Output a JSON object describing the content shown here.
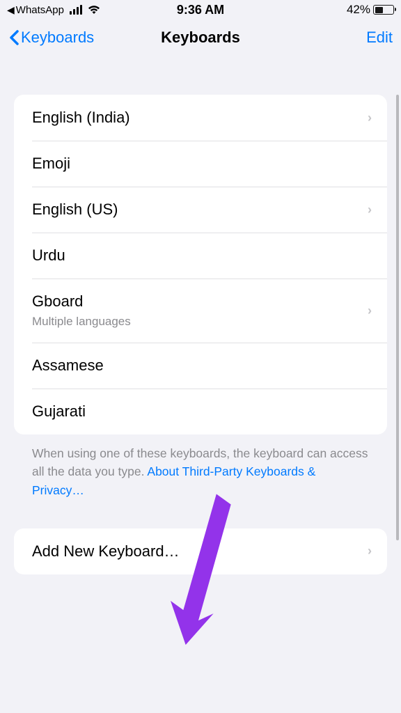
{
  "status_bar": {
    "back_app": "WhatsApp",
    "time": "9:36 AM",
    "battery_percent": "42%"
  },
  "nav": {
    "back_label": "Keyboards",
    "title": "Keyboards",
    "edit_label": "Edit"
  },
  "keyboards": [
    {
      "label": "English (India)",
      "has_chevron": true
    },
    {
      "label": "Emoji",
      "has_chevron": false
    },
    {
      "label": "English (US)",
      "has_chevron": true
    },
    {
      "label": "Urdu",
      "has_chevron": false
    },
    {
      "label": "Gboard",
      "sublabel": "Multiple languages",
      "has_chevron": true
    },
    {
      "label": "Assamese",
      "has_chevron": false
    },
    {
      "label": "Gujarati",
      "has_chevron": false
    }
  ],
  "footer": {
    "text_before": "When using one of these keyboards, the keyboard can access all the data you type. ",
    "link": "About Third-Party Keyboards & Privacy…"
  },
  "add_keyboard_label": "Add New Keyboard…",
  "colors": {
    "accent": "#007aff",
    "annotation": "#9333ea"
  }
}
